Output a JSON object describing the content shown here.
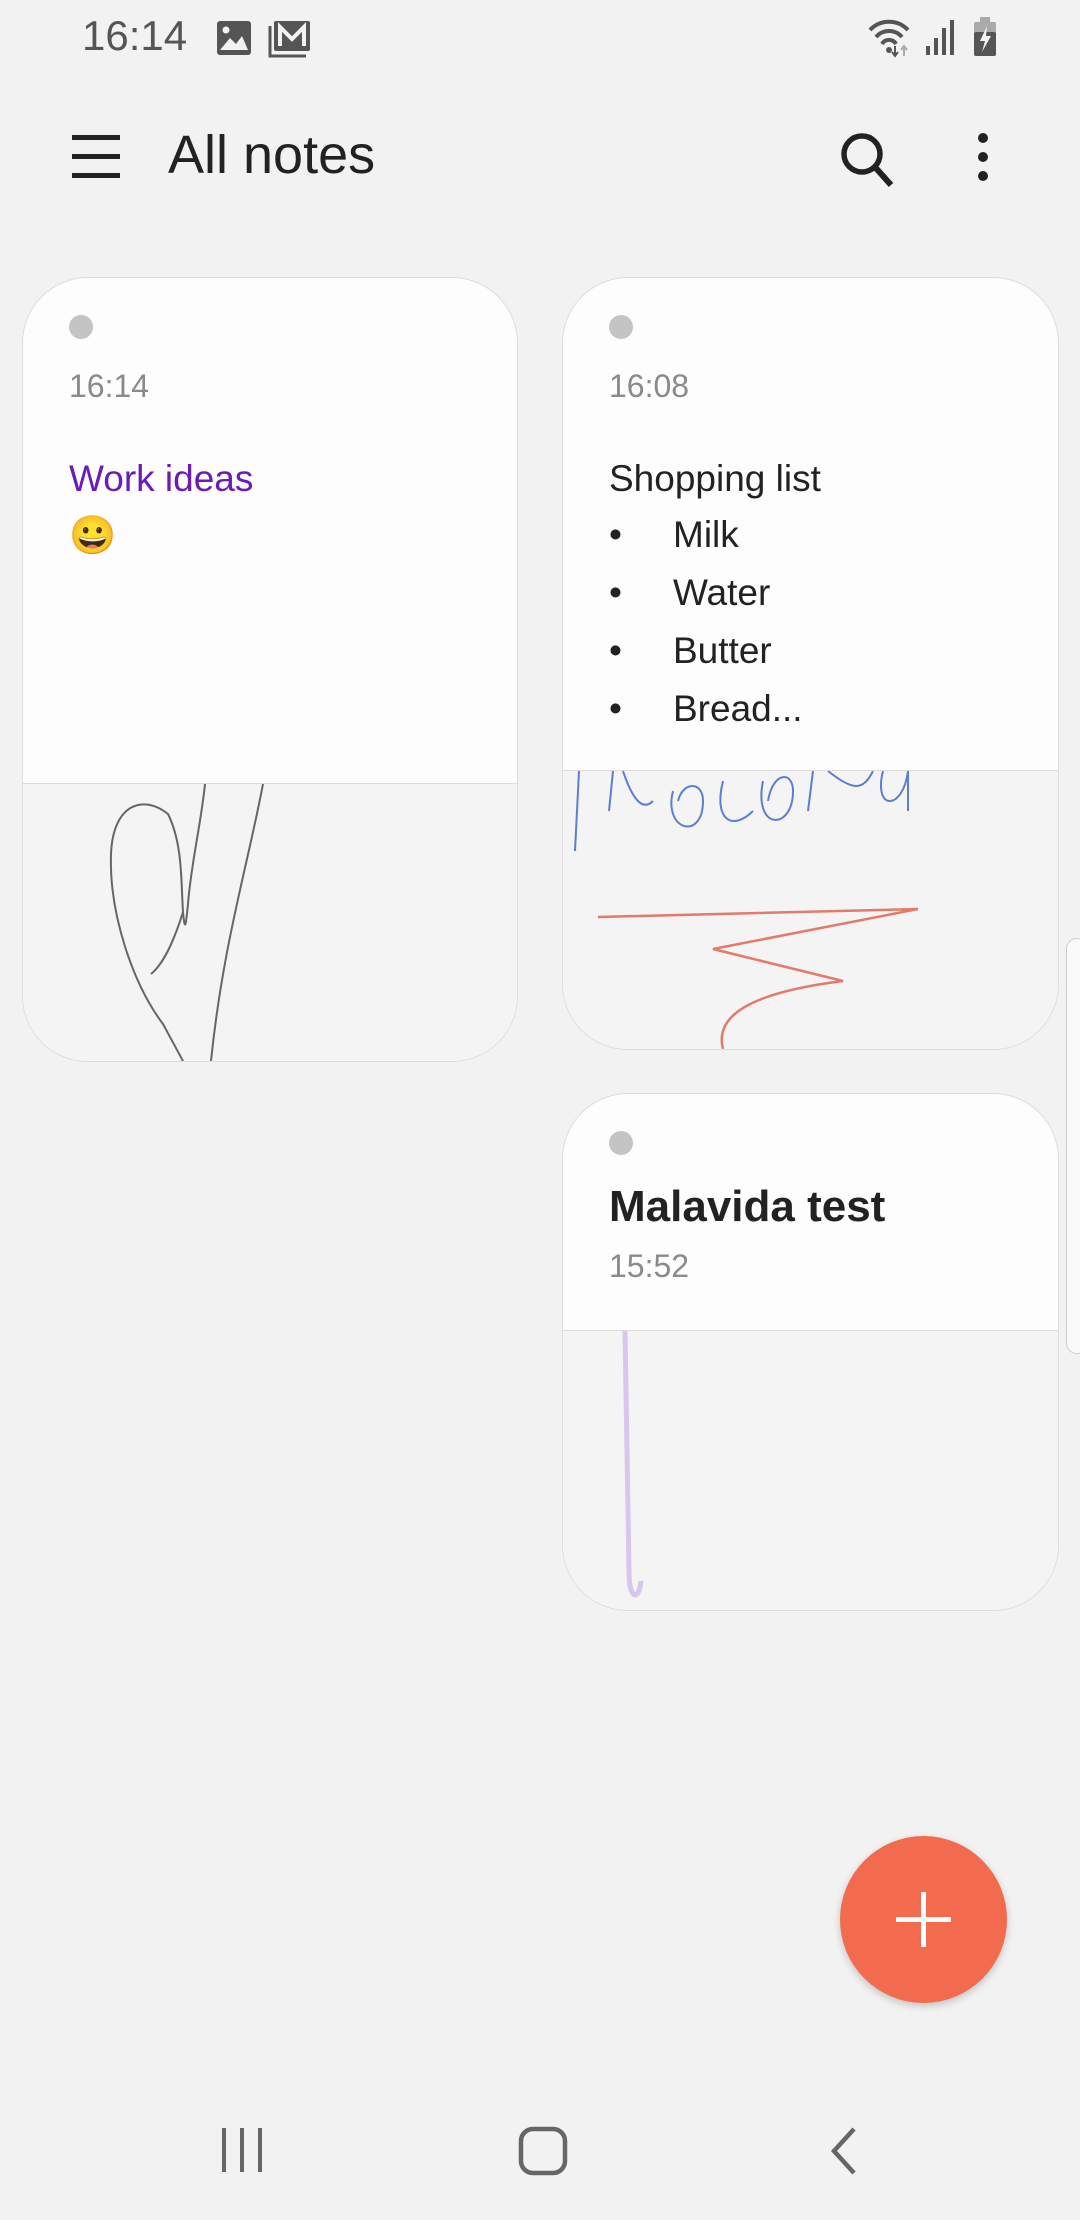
{
  "status_bar": {
    "time": "16:14",
    "left_icons": [
      "gallery-icon",
      "gmail-icon"
    ],
    "right_icons": [
      "wifi-icon",
      "signal-icon",
      "battery-charging-icon"
    ]
  },
  "header": {
    "title": "All notes",
    "menu_icon": "hamburger-icon",
    "search_icon": "search-icon",
    "more_icon": "more-vert-icon"
  },
  "notes": [
    {
      "time": "16:14",
      "title": "Work ideas",
      "emoji": "😀",
      "title_color": "#6a1bb8"
    },
    {
      "time": "16:08",
      "title": "Shopping list",
      "items": [
        "Milk",
        "Water",
        "Butter",
        "Bread..."
      ]
    },
    {
      "title": "Malavida test",
      "time": "15:52"
    }
  ],
  "fab": {
    "icon": "plus-icon",
    "color": "#f26b4f"
  },
  "nav_bar": {
    "icons": [
      "recents-icon",
      "home-icon",
      "back-icon"
    ]
  }
}
